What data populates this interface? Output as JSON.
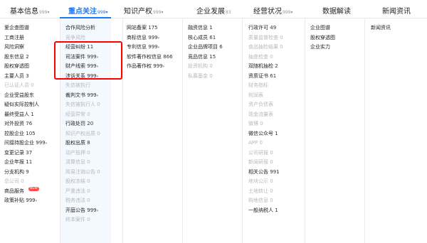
{
  "tabs": [
    {
      "label": "基本信息",
      "count": "999",
      "caret": "▾"
    },
    {
      "label": "重点关注",
      "count": "999",
      "caret": "▾"
    },
    {
      "label": "知识产权",
      "count": "999",
      "caret": "▾"
    },
    {
      "label": "企业发展",
      "count": "83",
      "caret": ""
    },
    {
      "label": "经营状况",
      "count": "999",
      "caret": "▾"
    },
    {
      "label": "数据解读",
      "count": "",
      "caret": ""
    },
    {
      "label": "新闻资讯",
      "count": "",
      "caret": ""
    }
  ],
  "columns": [
    [
      {
        "label": "爱企查图谱",
        "count": "",
        "dim": false
      },
      {
        "label": "工商注册",
        "count": "",
        "dim": false
      },
      {
        "label": "风险洞察",
        "count": "",
        "dim": false
      },
      {
        "label": "股东信息",
        "count": "2",
        "dim": false
      },
      {
        "label": "股权穿透图",
        "count": "",
        "dim": false
      },
      {
        "label": "主要人员",
        "count": "3",
        "dim": false
      },
      {
        "label": "已认证人员",
        "count": "0",
        "dim": true
      },
      {
        "label": "企业受益股东",
        "count": "",
        "dim": false
      },
      {
        "label": "疑似实际控制人",
        "count": "",
        "dim": false
      },
      {
        "label": "最终受益人",
        "count": "1",
        "dim": false
      },
      {
        "label": "对外投资",
        "count": "76",
        "dim": false
      },
      {
        "label": "控股企业",
        "count": "105",
        "dim": false
      },
      {
        "label": "间接持股企业",
        "count": "999",
        "dim": false,
        "caret": "▾"
      },
      {
        "label": "变更记录",
        "count": "37",
        "dim": false
      },
      {
        "label": "企业年报",
        "count": "11",
        "dim": false
      },
      {
        "label": "分支机构",
        "count": "9",
        "dim": false
      },
      {
        "label": "总公司",
        "count": "0",
        "dim": true
      },
      {
        "label": "商品服务",
        "count": "",
        "dim": false,
        "badge": "NEW"
      },
      {
        "label": "政策补贴",
        "count": "999",
        "dim": false,
        "caret": "▾"
      }
    ],
    [
      {
        "label": "合作风险分析",
        "count": "",
        "dim": false
      },
      {
        "label": "竞争风险",
        "count": "",
        "dim": true
      },
      {
        "label": "经营纠纷",
        "count": "11",
        "dim": false
      },
      {
        "label": "司法案件",
        "count": "999",
        "dim": false,
        "caret": "▾"
      },
      {
        "label": "财产线索",
        "count": "999",
        "dim": false,
        "caret": "▾"
      },
      {
        "label": "涉诉关系",
        "count": "999",
        "dim": false,
        "caret": "▾"
      },
      {
        "label": "失信被执行",
        "count": "",
        "dim": true
      },
      {
        "label": "裁判文书",
        "count": "999",
        "dim": false,
        "caret": "▾"
      },
      {
        "label": "失信被执行人",
        "count": "0",
        "dim": true
      },
      {
        "label": "经营异常",
        "count": "0",
        "dim": true
      },
      {
        "label": "行政处罚",
        "count": "20",
        "dim": false
      },
      {
        "label": "知识产权出质",
        "count": "0",
        "dim": true
      },
      {
        "label": "股权出质",
        "count": "8",
        "dim": false
      },
      {
        "label": "动产抵押",
        "count": "0",
        "dim": true
      },
      {
        "label": "清算信息",
        "count": "0",
        "dim": true
      },
      {
        "label": "简易注销公告",
        "count": "0",
        "dim": true
      },
      {
        "label": "股权冻结",
        "count": "0",
        "dim": true
      },
      {
        "label": "严重违法",
        "count": "0",
        "dim": true
      },
      {
        "label": "税务违法",
        "count": "0",
        "dim": true
      },
      {
        "label": "开庭公告",
        "count": "999",
        "dim": false,
        "caret": "▾"
      },
      {
        "label": "终本案件",
        "count": "0",
        "dim": true
      }
    ],
    [
      {
        "label": "网站备案",
        "count": "175",
        "dim": false
      },
      {
        "label": "商标信息",
        "count": "999",
        "dim": false,
        "caret": "▾"
      },
      {
        "label": "专利信息",
        "count": "999",
        "dim": false,
        "caret": "▾"
      },
      {
        "label": "软件著作权信息",
        "count": "866",
        "dim": false
      },
      {
        "label": "作品著作权",
        "count": "999",
        "dim": false,
        "caret": "▾"
      }
    ],
    [
      {
        "label": "融资信息",
        "count": "1",
        "dim": false
      },
      {
        "label": "核心成员",
        "count": "61",
        "dim": false
      },
      {
        "label": "企业品牌项目",
        "count": "6",
        "dim": false
      },
      {
        "label": "竞品信息",
        "count": "15",
        "dim": false
      },
      {
        "label": "投资机构",
        "count": "0",
        "dim": true
      },
      {
        "label": "私募基金",
        "count": "0",
        "dim": true
      }
    ],
    [
      {
        "label": "行政许可",
        "count": "49",
        "dim": false
      },
      {
        "label": "质量监督检查",
        "count": "0",
        "dim": true
      },
      {
        "label": "食品抽检结果",
        "count": "0",
        "dim": true
      },
      {
        "label": "抽查检查",
        "count": "0",
        "dim": true
      },
      {
        "label": "双随机抽检",
        "count": "2",
        "dim": false
      },
      {
        "label": "资质证书",
        "count": "61",
        "dim": false
      },
      {
        "label": "财务指标",
        "count": "",
        "dim": true
      },
      {
        "label": "利润表",
        "count": "",
        "dim": true
      },
      {
        "label": "资产负债表",
        "count": "",
        "dim": true
      },
      {
        "label": "现金流量表",
        "count": "",
        "dim": true
      },
      {
        "label": "微博",
        "count": "0",
        "dim": true
      },
      {
        "label": "微信公众号",
        "count": "1",
        "dim": false
      },
      {
        "label": "APP",
        "count": "0",
        "dim": true
      },
      {
        "label": "公司研报",
        "count": "0",
        "dim": true
      },
      {
        "label": "新闻研报",
        "count": "0",
        "dim": true
      },
      {
        "label": "相关公告",
        "count": "991",
        "dim": false
      },
      {
        "label": "地块公示",
        "count": "0",
        "dim": true
      },
      {
        "label": "土地转让",
        "count": "0",
        "dim": true
      },
      {
        "label": "购地信息",
        "count": "0",
        "dim": true
      },
      {
        "label": "一般纳税人",
        "count": "1",
        "dim": false
      }
    ],
    [
      {
        "label": "企业图谱",
        "count": "",
        "dim": false
      },
      {
        "label": "股权穿透图",
        "count": "",
        "dim": false
      },
      {
        "label": "企业实力",
        "count": "",
        "dim": false
      }
    ],
    [
      {
        "label": "新闻资讯",
        "count": "",
        "dim": false
      }
    ]
  ]
}
